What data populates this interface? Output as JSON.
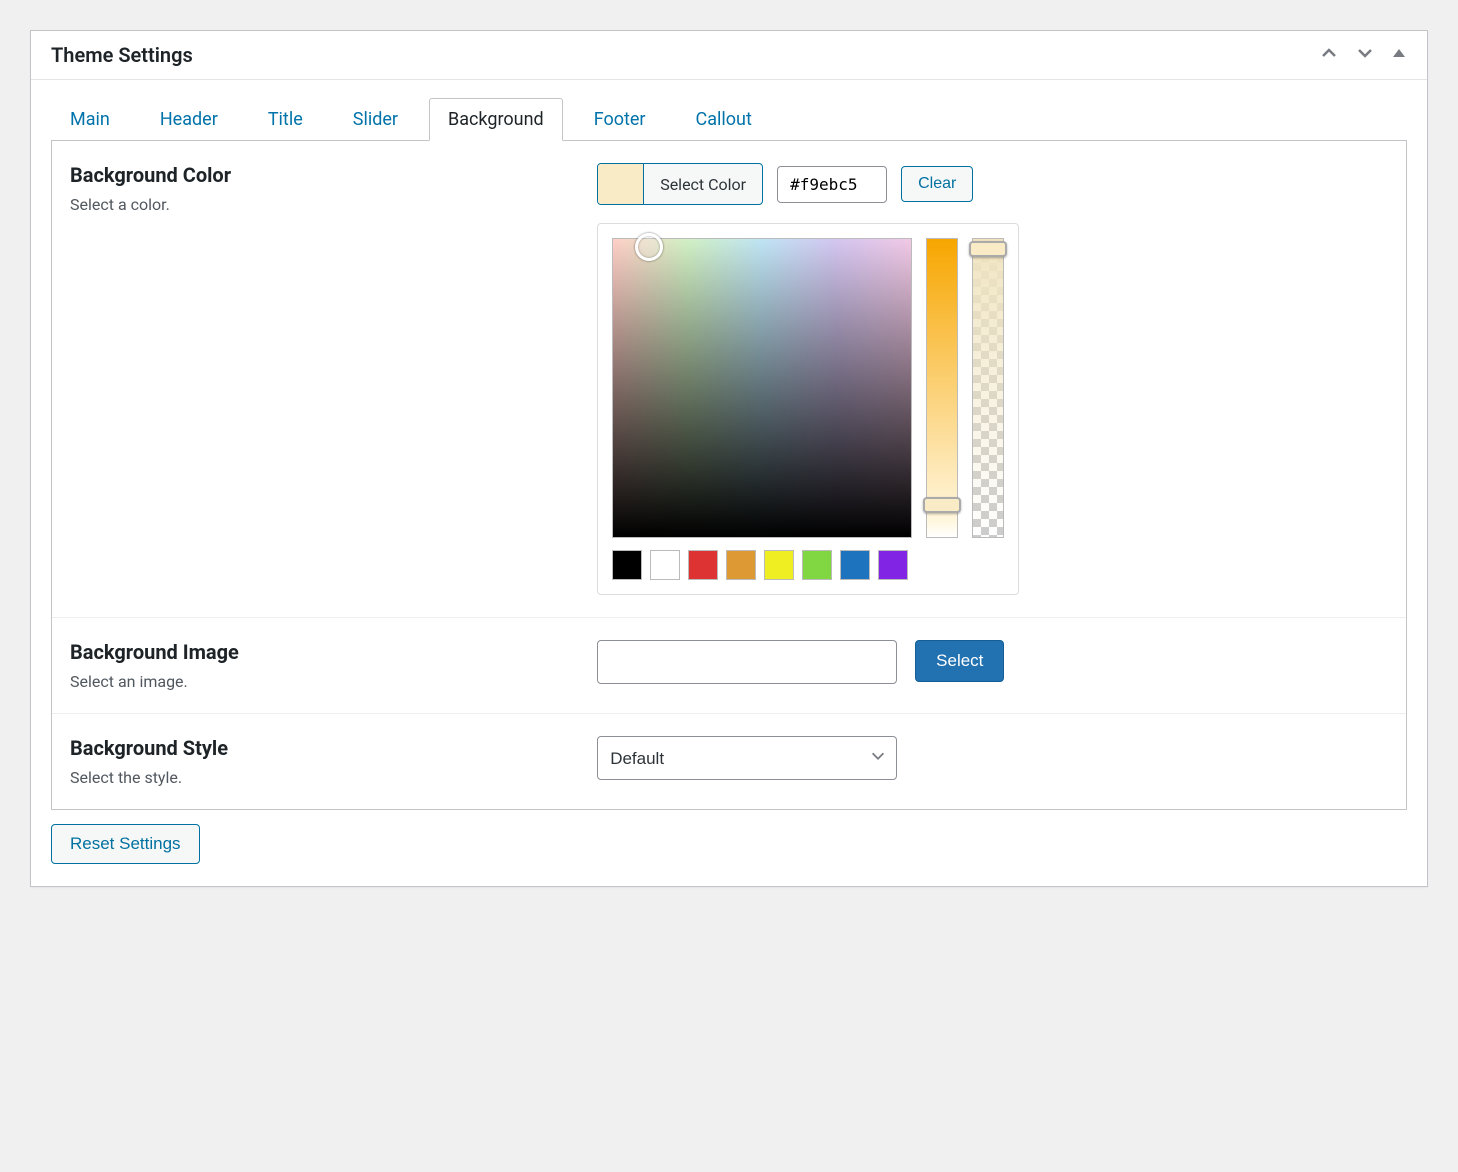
{
  "panel": {
    "title": "Theme Settings"
  },
  "tabs": [
    "Main",
    "Header",
    "Title",
    "Slider",
    "Background",
    "Footer",
    "Callout"
  ],
  "active_tab": "Background",
  "fields": {
    "bg_color": {
      "title": "Background Color",
      "desc": "Select a color.",
      "select_color_label": "Select Color",
      "hex_value": "#f9ebc5",
      "clear_label": "Clear",
      "preset_swatches": [
        "#000000",
        "#ffffff",
        "#dd3333",
        "#dd9933",
        "#eeee22",
        "#81d742",
        "#1e73be",
        "#8224e3"
      ]
    },
    "bg_image": {
      "title": "Background Image",
      "desc": "Select an image.",
      "value": "",
      "select_label": "Select"
    },
    "bg_style": {
      "title": "Background Style",
      "desc": "Select the style.",
      "selected": "Default"
    }
  },
  "footer": {
    "reset_label": "Reset Settings"
  }
}
